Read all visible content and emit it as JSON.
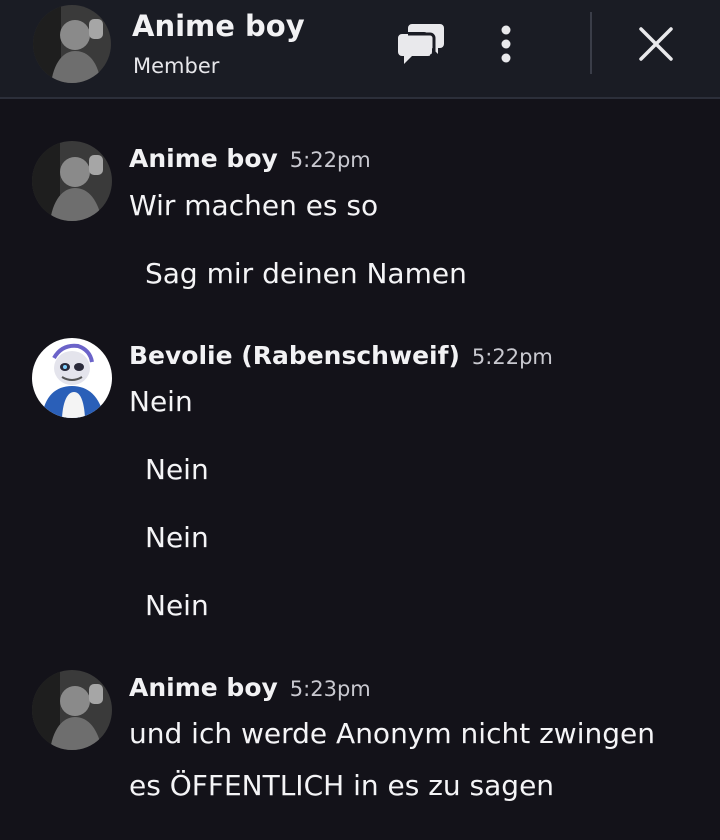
{
  "header": {
    "title": "Anime boy",
    "subtitle": "Member",
    "icons": [
      "avatar",
      "chat-bubbles-icon",
      "more-vertical-icon",
      "close-icon"
    ]
  },
  "messages": [
    {
      "author": "Anime boy",
      "time": "5:22pm",
      "lines": [
        "Wir machen es so",
        "Sag mir deinen Namen"
      ]
    },
    {
      "author": "Bevolie (Rabenschweif)",
      "time": "5:22pm",
      "lines": [
        "Nein",
        "Nein",
        "Nein",
        "Nein"
      ]
    },
    {
      "author": "Anime boy",
      "time": "5:23pm",
      "lines": [
        "und ich werde Anonym nicht zwingen",
        "es ÖFFENTLICH in es zu sagen"
      ]
    }
  ],
  "colors": {
    "background": "#131219",
    "header_background": "#1a1c24",
    "text": "#f2f2f4",
    "timestamp": "#c9c9d0"
  }
}
